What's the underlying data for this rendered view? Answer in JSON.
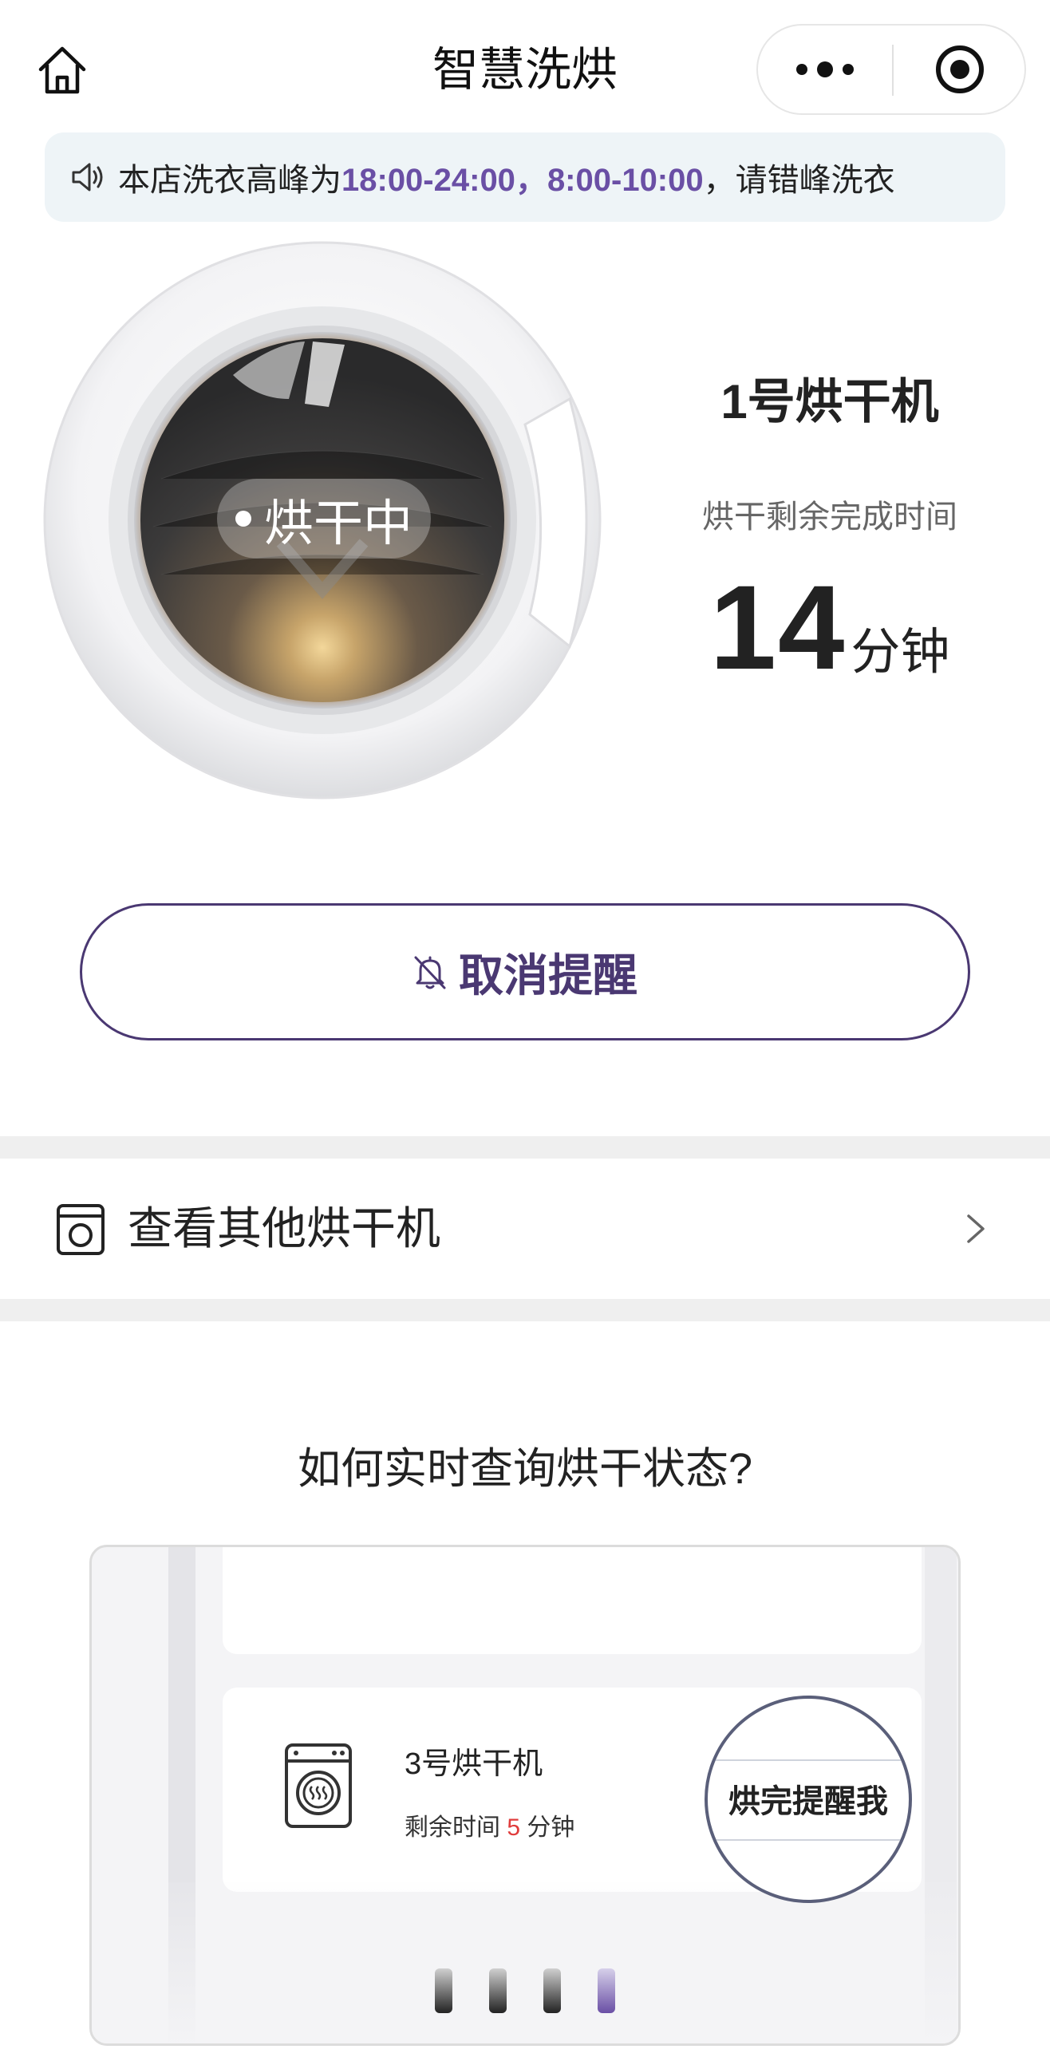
{
  "header": {
    "title": "智慧洗烘"
  },
  "notice": {
    "prefix": "本店洗衣高峰为",
    "peak1": "18:00-24:00",
    "sep": "，",
    "peak2": "8:00-10:00",
    "suffix": "，请错峰洗衣",
    "highlight_color": "#6a4fa5"
  },
  "machine": {
    "status": "烘干中",
    "name": "1号烘干机",
    "remain_label": "烘干剩余完成时间",
    "remain_value": "14",
    "remain_unit": "分钟"
  },
  "cancel_button": {
    "label": "取消提醒",
    "color": "#4a3872"
  },
  "other_dryers": {
    "label": "查看其他烘干机"
  },
  "howto": {
    "title": "如何实时查询烘干状态?",
    "demo_machine_name": "3号烘干机",
    "demo_remain_prefix": "剩余时间",
    "demo_remain_value": "5",
    "demo_remain_unit": "分钟",
    "demo_button": "烘完提醒我",
    "active_page_index": 4,
    "page_count": 4
  },
  "icons": [
    "home-icon",
    "more-icon",
    "close-target-icon",
    "speaker-icon",
    "bell-off-icon",
    "dryer-icon",
    "chevron-right-icon",
    "washer-icon"
  ]
}
